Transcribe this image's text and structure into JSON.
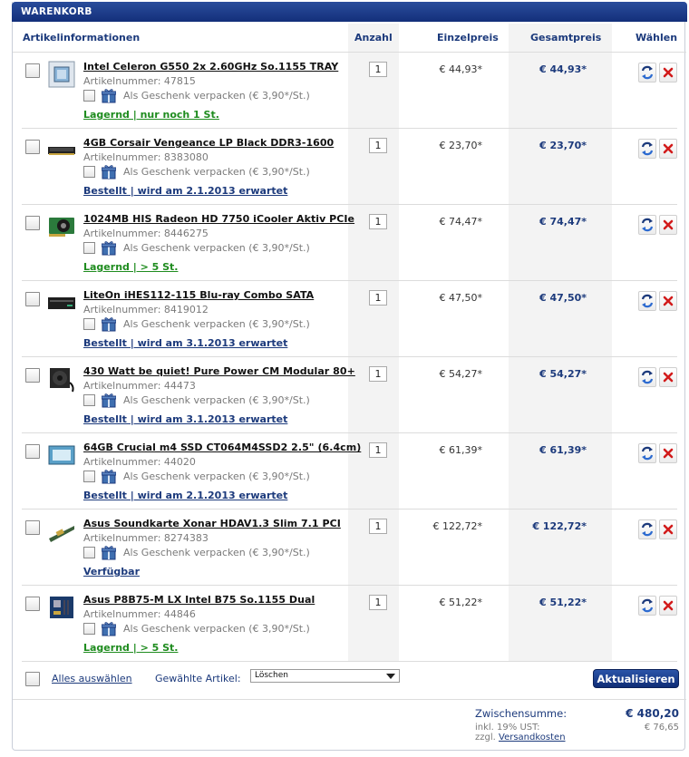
{
  "header": {
    "title": "WARENKORB"
  },
  "columns": {
    "info": "Artikelinformationen",
    "qty": "Anzahl",
    "single": "Einzelpreis",
    "total": "Gesamtpreis",
    "choose": "Wählen"
  },
  "gift_text": "Als Geschenk verpacken (€ 3,90*/St.)",
  "items": [
    {
      "name": "Intel Celeron G550 2x 2.60GHz So.1155 TRAY",
      "article": "Artikelnummer: 47815",
      "availability": "Lagernd | nur noch 1 St.",
      "avail_color": "green",
      "qty": "1",
      "single": "€ 44,93*",
      "total": "€ 44,93*",
      "thumb": "cpu-thumbnail"
    },
    {
      "name": "4GB Corsair Vengeance LP Black DDR3-1600",
      "article": "Artikelnummer: 8383080",
      "availability": "Bestellt | wird am 2.1.2013 erwartet",
      "avail_color": "blue",
      "qty": "1",
      "single": "€ 23,70*",
      "total": "€ 23,70*",
      "thumb": "ram-thumbnail"
    },
    {
      "name": "1024MB HIS Radeon HD 7750 iCooler Aktiv PCIe",
      "article": "Artikelnummer: 8446275",
      "availability": "Lagernd | > 5 St.",
      "avail_color": "green",
      "qty": "1",
      "single": "€ 74,47*",
      "total": "€ 74,47*",
      "thumb": "gpu-thumbnail"
    },
    {
      "name": "LiteOn iHES112-115 Blu-ray Combo SATA",
      "article": "Artikelnummer: 8419012",
      "availability": "Bestellt | wird am 3.1.2013 erwartet",
      "avail_color": "blue",
      "qty": "1",
      "single": "€ 47,50*",
      "total": "€ 47,50*",
      "thumb": "drive-thumbnail"
    },
    {
      "name": "430 Watt be quiet! Pure Power CM Modular 80+",
      "article": "Artikelnummer: 44473",
      "availability": "Bestellt | wird am 3.1.2013 erwartet",
      "avail_color": "blue",
      "qty": "1",
      "single": "€ 54,27*",
      "total": "€ 54,27*",
      "thumb": "psu-thumbnail"
    },
    {
      "name": "64GB Crucial m4 SSD CT064M4SSD2 2.5\" (6.4cm)",
      "article": "Artikelnummer: 44020",
      "availability": "Bestellt | wird am 2.1.2013 erwartet",
      "avail_color": "blue",
      "qty": "1",
      "single": "€ 61,39*",
      "total": "€ 61,39*",
      "thumb": "ssd-thumbnail"
    },
    {
      "name": "Asus Soundkarte Xonar HDAV1.3 Slim 7.1 PCI",
      "article": "Artikelnummer: 8274383",
      "availability": "Verfügbar",
      "avail_color": "blue",
      "qty": "1",
      "single": "€ 122,72*",
      "total": "€ 122,72*",
      "thumb": "soundcard-thumbnail"
    },
    {
      "name": "Asus P8B75-M LX Intel B75 So.1155 Dual",
      "article": "Artikelnummer: 44846",
      "availability": "Lagernd | > 5 St.",
      "avail_color": "green",
      "qty": "1",
      "single": "€ 51,22*",
      "total": "€ 51,22*",
      "thumb": "mainboard-thumbnail"
    }
  ],
  "footer": {
    "select_all": "Alles auswählen",
    "selected_label": "Gewählte Artikel:",
    "selected_action": "Löschen",
    "update_button": "Aktualisieren"
  },
  "summary": {
    "subtotal_label": "Zwischensumme:",
    "subtotal_value": "€ 480,20",
    "tax_label": "inkl. 19% UST:",
    "tax_value": "€ 76,65",
    "shipping_prefix": "zzgl.",
    "shipping_link": "Versandkosten"
  },
  "colors": {
    "header": "#1c3a7c",
    "green": "#1f8c1f",
    "accent": "#1c3a7c"
  }
}
